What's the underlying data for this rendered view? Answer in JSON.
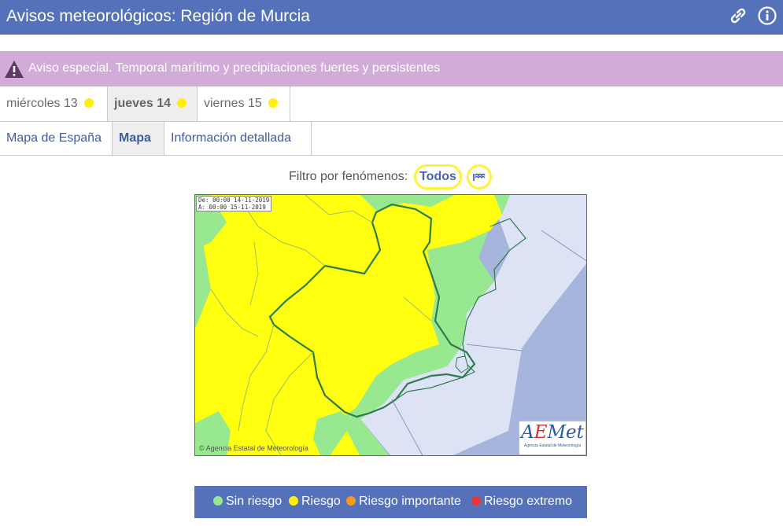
{
  "header": {
    "title": "Avisos meteorológicos: Región de Murcia"
  },
  "alert": {
    "text": "Aviso especial. Temporal marítimo y precipitaciones fuertes y persistentes"
  },
  "days": [
    {
      "label": "miércoles 13",
      "active": false,
      "risk_color": "#ffef0a"
    },
    {
      "label": "jueves 14",
      "active": true,
      "risk_color": "#ffef0a"
    },
    {
      "label": "viernes 15",
      "active": false,
      "risk_color": "#ffef0a"
    }
  ],
  "views": [
    {
      "label": "Mapa de España",
      "active": false
    },
    {
      "label": "Mapa",
      "active": true
    },
    {
      "label": "Información detallada",
      "active": false
    }
  ],
  "filter": {
    "label": "Filtro por fenómenos:",
    "all_label": "Todos",
    "icon": "coastal-wave-icon"
  },
  "map": {
    "valid_from": "De: 00:00 14-11-2019",
    "valid_to": "A:  00:00 15-11-2019",
    "credit": "Agencia Estatal de Meteorología",
    "logo": {
      "word_prefix": "A",
      "word_highlight": "E",
      "word_suffix": "Met",
      "subtitle": "Agencia Estatal de Meteorología"
    }
  },
  "legend": [
    {
      "label": "Sin riesgo",
      "color": "#97e88f"
    },
    {
      "label": "Riesgo",
      "color": "#ffef0a"
    },
    {
      "label": "Riesgo importante",
      "color": "#f59a1c"
    },
    {
      "label": "Riesgo extremo",
      "color": "#e8353a"
    }
  ],
  "colors": {
    "header": "#5571b9",
    "alert": "#d2acd9",
    "yellow": "#ffff0f",
    "green": "#97e88f",
    "sea_light": "#dde3f4",
    "sea_dark": "#a6b5db"
  }
}
